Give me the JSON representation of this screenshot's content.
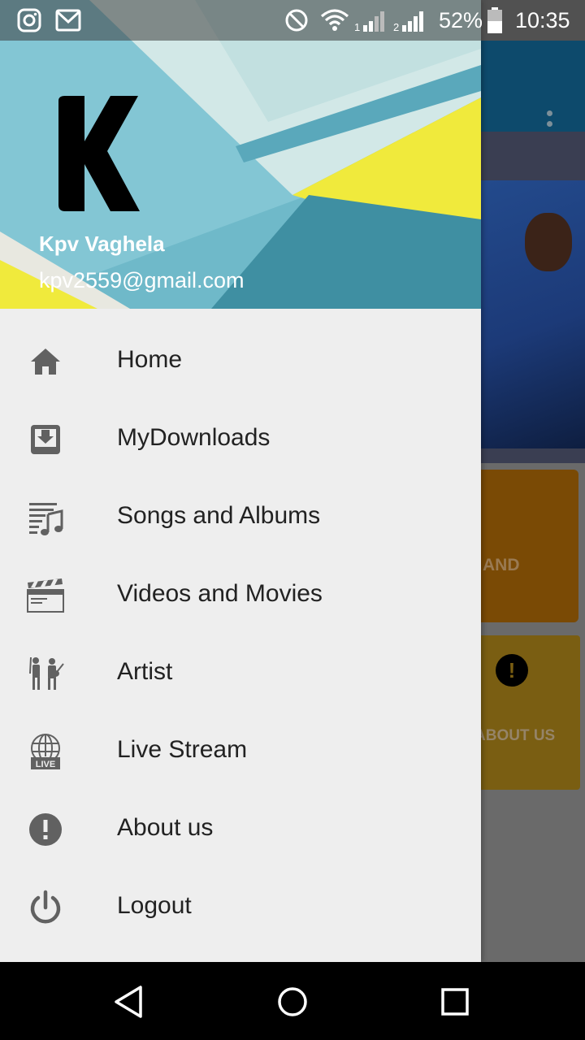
{
  "status_bar": {
    "left_icons": [
      "instagram-icon",
      "gmail-icon"
    ],
    "right_icons": [
      "do-not-disturb-icon",
      "wifi-icon",
      "signal-sim1-icon",
      "signal-sim2-icon",
      "battery-icon"
    ],
    "sim1_label": "1",
    "sim2_label": "2",
    "battery": "52%",
    "time": "10:35"
  },
  "drawer": {
    "header": {
      "logo_letter": "K",
      "user_name": "Kpv Vaghela",
      "user_email": "kpv2559@gmail.com",
      "colors": {
        "teal": "#73bccb",
        "dark_teal": "#3b8a9d",
        "light": "#cde6e6",
        "yellow": "#f0ea3c"
      }
    },
    "menu": [
      {
        "label": "Home",
        "icon": "home-icon"
      },
      {
        "label": "MyDownloads",
        "icon": "downloads-icon"
      },
      {
        "label": "Songs and Albums",
        "icon": "music-list-icon"
      },
      {
        "label": "Videos and Movies",
        "icon": "clapperboard-icon"
      },
      {
        "label": "Artist",
        "icon": "artists-icon"
      },
      {
        "label": "Live Stream",
        "icon": "live-globe-icon"
      },
      {
        "label": "About us",
        "icon": "info-exclamation-icon"
      },
      {
        "label": "Logout",
        "icon": "power-icon"
      }
    ],
    "live_badge": "LIVE"
  },
  "background_app": {
    "card1_label": "AND",
    "card2_label": "ABOUT US",
    "card2_icon": "!"
  },
  "nav_bar": {
    "buttons": [
      "back-icon",
      "home-circle-icon",
      "recents-icon"
    ]
  }
}
